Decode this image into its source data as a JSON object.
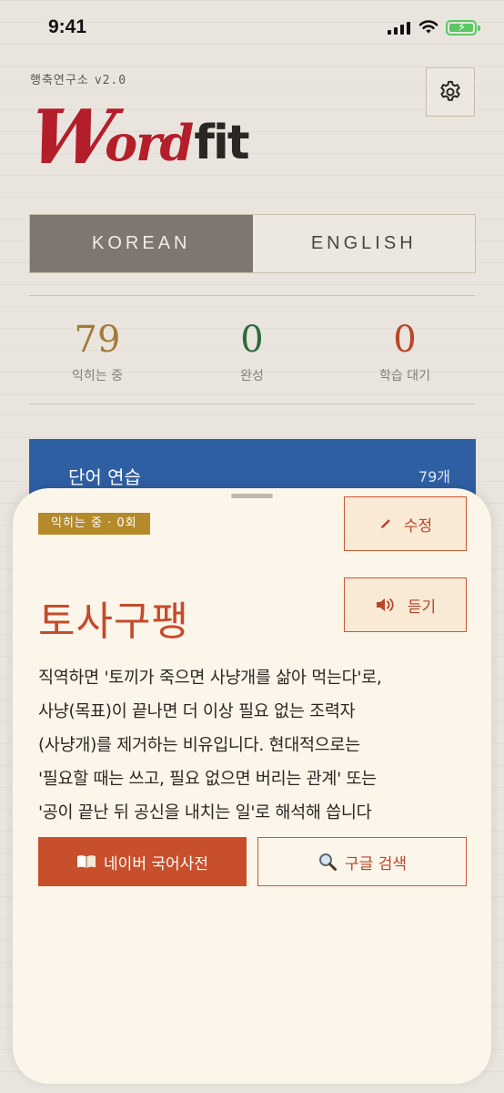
{
  "status": {
    "time": "9:41"
  },
  "header": {
    "org": "행축연구소",
    "version": "v2.0",
    "logo_w": "W",
    "logo_ord": "ord",
    "logo_fit": "fit"
  },
  "lang_tabs": [
    {
      "label": "KOREAN",
      "active": true
    },
    {
      "label": "ENGLISH",
      "active": false
    }
  ],
  "stats": [
    {
      "value": "79",
      "label": "익히는 중",
      "color": "#a6793a"
    },
    {
      "value": "0",
      "label": "완성",
      "color": "#2e6a3e"
    },
    {
      "value": "0",
      "label": "학습 대기",
      "color": "#b8452a"
    }
  ],
  "practice": {
    "title": "단어 연습",
    "count": "79개"
  },
  "sheet": {
    "badge": "익히는 중 · 0회",
    "edit_label": "수정",
    "listen_label": "듣기",
    "word": "토사구팽",
    "meaning_lines": [
      "직역하면 '토끼가 죽으면 사냥개를 삶아 먹는다'로,",
      "사냥(목표)이 끝나면 더 이상 필요 없는 조력자",
      "(사냥개)를 제거하는 비유입니다. 현대적으로는",
      "'필요할 때는 쓰고, 필요 없으면 버리는 관계' 또는",
      "'공이 끝난 뒤 공신을 내치는 일'로 해석해 씁니다"
    ],
    "naver_label": "네이버 국어사전",
    "google_label": "구글 검색"
  },
  "colors": {
    "brand_red": "#b41e2a",
    "accent": "#c84f2b",
    "practice_blue": "#2f5fa3",
    "badge_gold": "#b58a2a"
  }
}
